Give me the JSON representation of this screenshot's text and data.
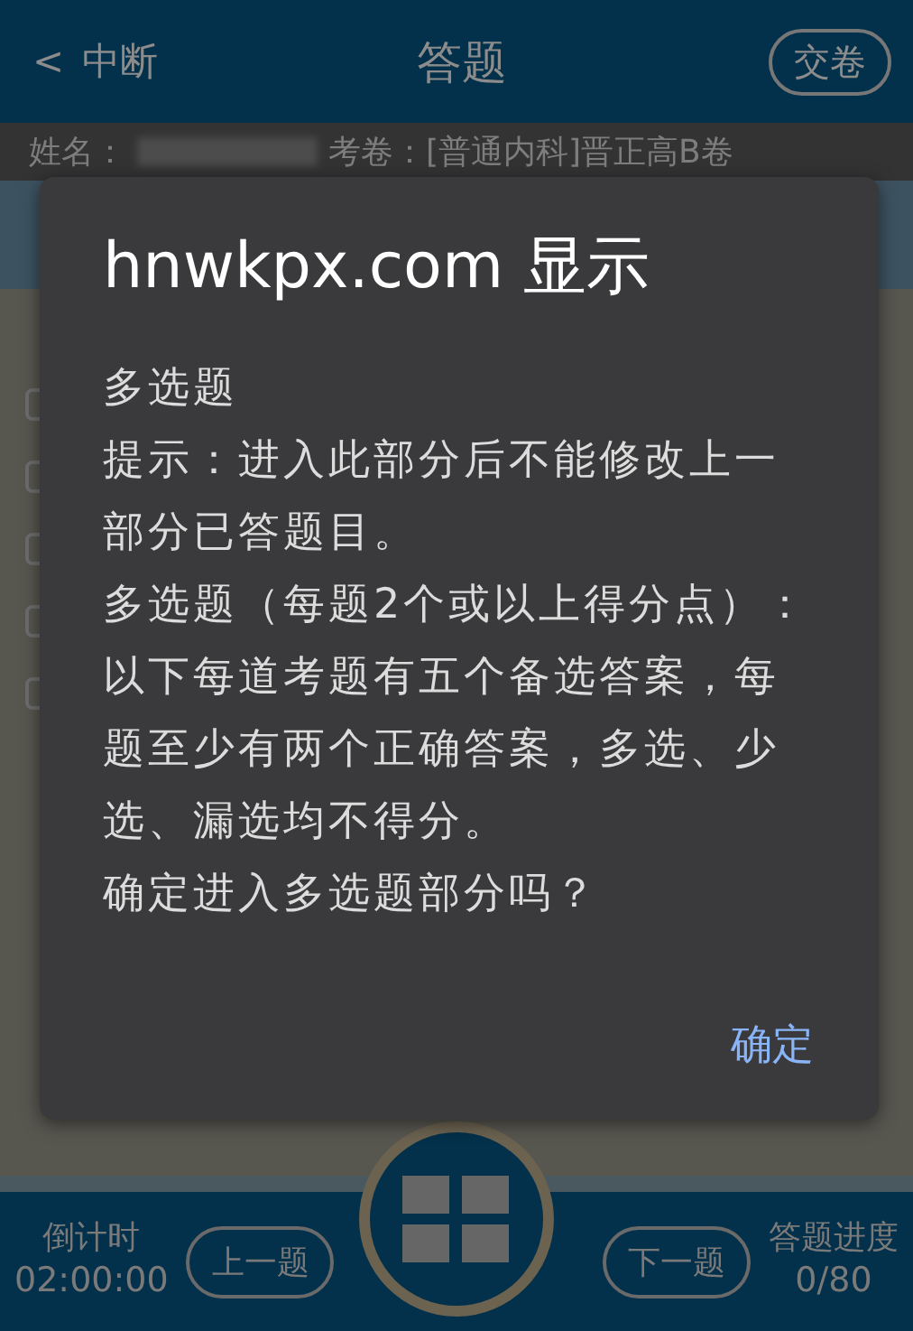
{
  "header": {
    "back_icon": "<",
    "back_label": "中断",
    "title": "答题",
    "submit": "交卷"
  },
  "info_bar": {
    "name_label": "姓名：",
    "exam_label": "考卷：[普通内科]晋正高B卷"
  },
  "options": [
    {
      "checked": false
    },
    {
      "checked": false
    },
    {
      "checked": false
    },
    {
      "checked": false
    },
    {
      "checked": false
    }
  ],
  "dialog": {
    "title": "hnwkpx.com 显示",
    "lines": [
      "多选题",
      "提示：进入此部分后不能修改上一部分已答题目。",
      "多选题（每题2个或以上得分点）：以下每道考题有五个备选答案，每题至少有两个正确答案，多选、少选、漏选均不得分。",
      "确定进入多选题部分吗？"
    ],
    "ok": "确定"
  },
  "footer": {
    "timer_label": "倒计时",
    "timer": "02:00:00",
    "prev": "上一题",
    "next": "下一题",
    "progress_label": "答题进度",
    "progress": "0/80"
  }
}
